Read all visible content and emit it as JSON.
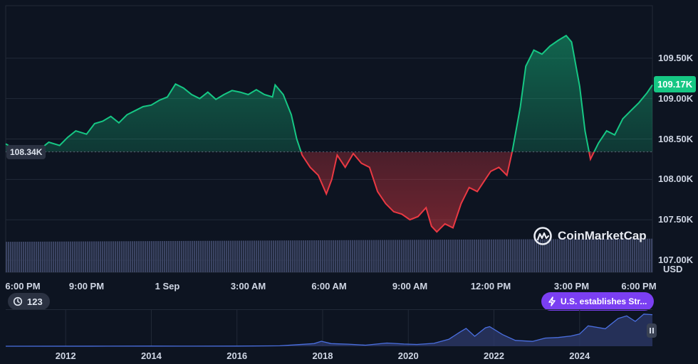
{
  "chart_data": {
    "type": "area",
    "price": {
      "unit": "USD",
      "ylim": [
        106850,
        110150
      ],
      "open_value": 108340,
      "open_label": "108.34K",
      "current_value": 109170,
      "current_label": "109.17K",
      "y_ticks": [
        {
          "value": 109500,
          "label": "109.50K"
        },
        {
          "value": 109000,
          "label": "109.00K"
        },
        {
          "value": 108500,
          "label": "108.50K"
        },
        {
          "value": 108000,
          "label": "108.00K"
        },
        {
          "value": 107500,
          "label": "107.50K"
        },
        {
          "value": 107000,
          "label": "107.00K"
        }
      ],
      "x_ticks": [
        {
          "hour": 0,
          "label": "6:00 PM"
        },
        {
          "hour": 3,
          "label": "9:00 PM"
        },
        {
          "hour": 6,
          "label": "1 Sep"
        },
        {
          "hour": 9,
          "label": "3:00 AM"
        },
        {
          "hour": 12,
          "label": "6:00 AM"
        },
        {
          "hour": 15,
          "label": "9:00 AM"
        },
        {
          "hour": 18,
          "label": "12:00 PM"
        },
        {
          "hour": 21,
          "label": "3:00 PM"
        },
        {
          "hour": 24,
          "label": "6:00 PM"
        }
      ],
      "points": [
        [
          0.0,
          108440
        ],
        [
          0.3,
          108380
        ],
        [
          0.6,
          108300
        ],
        [
          1.0,
          108330
        ],
        [
          1.3,
          108380
        ],
        [
          1.6,
          108460
        ],
        [
          2.0,
          108420
        ],
        [
          2.3,
          108520
        ],
        [
          2.6,
          108600
        ],
        [
          3.0,
          108560
        ],
        [
          3.3,
          108690
        ],
        [
          3.6,
          108720
        ],
        [
          3.9,
          108780
        ],
        [
          4.2,
          108700
        ],
        [
          4.5,
          108800
        ],
        [
          4.8,
          108850
        ],
        [
          5.1,
          108900
        ],
        [
          5.4,
          108920
        ],
        [
          5.7,
          108980
        ],
        [
          6.0,
          109020
        ],
        [
          6.3,
          109180
        ],
        [
          6.6,
          109130
        ],
        [
          6.9,
          109050
        ],
        [
          7.2,
          109000
        ],
        [
          7.5,
          109080
        ],
        [
          7.8,
          108990
        ],
        [
          8.1,
          109050
        ],
        [
          8.4,
          109100
        ],
        [
          8.7,
          109080
        ],
        [
          9.0,
          109050
        ],
        [
          9.3,
          109110
        ],
        [
          9.6,
          109050
        ],
        [
          9.9,
          109020
        ],
        [
          10.0,
          109170
        ],
        [
          10.3,
          109050
        ],
        [
          10.6,
          108800
        ],
        [
          10.8,
          108500
        ],
        [
          11.0,
          108300
        ],
        [
          11.3,
          108150
        ],
        [
          11.6,
          108050
        ],
        [
          11.9,
          107820
        ],
        [
          12.1,
          108000
        ],
        [
          12.3,
          108300
        ],
        [
          12.6,
          108150
        ],
        [
          12.9,
          108320
        ],
        [
          13.2,
          108200
        ],
        [
          13.5,
          108150
        ],
        [
          13.8,
          107850
        ],
        [
          14.1,
          107700
        ],
        [
          14.4,
          107600
        ],
        [
          14.7,
          107570
        ],
        [
          15.0,
          107500
        ],
        [
          15.3,
          107540
        ],
        [
          15.6,
          107650
        ],
        [
          15.8,
          107420
        ],
        [
          16.0,
          107350
        ],
        [
          16.3,
          107450
        ],
        [
          16.6,
          107400
        ],
        [
          16.9,
          107700
        ],
        [
          17.2,
          107900
        ],
        [
          17.5,
          107850
        ],
        [
          17.8,
          108000
        ],
        [
          18.0,
          108100
        ],
        [
          18.3,
          108150
        ],
        [
          18.6,
          108050
        ],
        [
          18.8,
          108350
        ],
        [
          19.1,
          108900
        ],
        [
          19.3,
          109400
        ],
        [
          19.6,
          109600
        ],
        [
          19.9,
          109550
        ],
        [
          20.2,
          109650
        ],
        [
          20.5,
          109720
        ],
        [
          20.8,
          109780
        ],
        [
          21.0,
          109700
        ],
        [
          21.3,
          109150
        ],
        [
          21.5,
          108600
        ],
        [
          21.7,
          108250
        ],
        [
          22.0,
          108450
        ],
        [
          22.3,
          108600
        ],
        [
          22.6,
          108550
        ],
        [
          22.9,
          108750
        ],
        [
          23.2,
          108850
        ],
        [
          23.5,
          108950
        ],
        [
          23.8,
          109070
        ],
        [
          24.0,
          109170
        ]
      ]
    },
    "volume": {
      "ylim": [
        0,
        1
      ],
      "start": 0.78,
      "end": 0.86
    },
    "history": {
      "x_ticks": [
        {
          "year": 2012,
          "label": "2012"
        },
        {
          "year": 2014,
          "label": "2014"
        },
        {
          "year": 2016,
          "label": "2016"
        },
        {
          "year": 2018,
          "label": "2018"
        },
        {
          "year": 2020,
          "label": "2020"
        },
        {
          "year": 2022,
          "label": "2022"
        },
        {
          "year": 2024,
          "label": "2024"
        }
      ],
      "xlim": [
        2010.6,
        2025.7
      ],
      "ylim": [
        0,
        112000
      ],
      "points": [
        [
          2010.6,
          0
        ],
        [
          2013.0,
          150
        ],
        [
          2014.0,
          500
        ],
        [
          2015.0,
          300
        ],
        [
          2016.0,
          500
        ],
        [
          2017.0,
          1500
        ],
        [
          2017.8,
          9000
        ],
        [
          2017.97,
          17000
        ],
        [
          2018.2,
          9000
        ],
        [
          2018.6,
          7000
        ],
        [
          2019.0,
          3700
        ],
        [
          2019.5,
          11000
        ],
        [
          2019.9,
          7500
        ],
        [
          2020.2,
          6000
        ],
        [
          2020.6,
          10000
        ],
        [
          2020.95,
          24000
        ],
        [
          2021.2,
          48000
        ],
        [
          2021.35,
          61000
        ],
        [
          2021.55,
          34000
        ],
        [
          2021.8,
          63000
        ],
        [
          2021.9,
          67000
        ],
        [
          2022.2,
          40000
        ],
        [
          2022.5,
          20000
        ],
        [
          2022.9,
          16500
        ],
        [
          2023.2,
          28000
        ],
        [
          2023.5,
          30000
        ],
        [
          2023.8,
          35000
        ],
        [
          2024.0,
          42000
        ],
        [
          2024.2,
          70000
        ],
        [
          2024.6,
          60000
        ],
        [
          2024.9,
          95000
        ],
        [
          2025.1,
          104000
        ],
        [
          2025.3,
          85000
        ],
        [
          2025.5,
          110000
        ],
        [
          2025.7,
          108000
        ]
      ]
    }
  },
  "ui": {
    "currency": "USD",
    "watermark": "CoinMarketCap",
    "events_count": "123",
    "news_pill": "U.S. establishes Str...",
    "colors": {
      "background": "#0d1421",
      "up": "#16c784",
      "down": "#ea3943",
      "grid": "#222a38",
      "volume": "#3b4463",
      "news": "#7b3ff2"
    }
  }
}
